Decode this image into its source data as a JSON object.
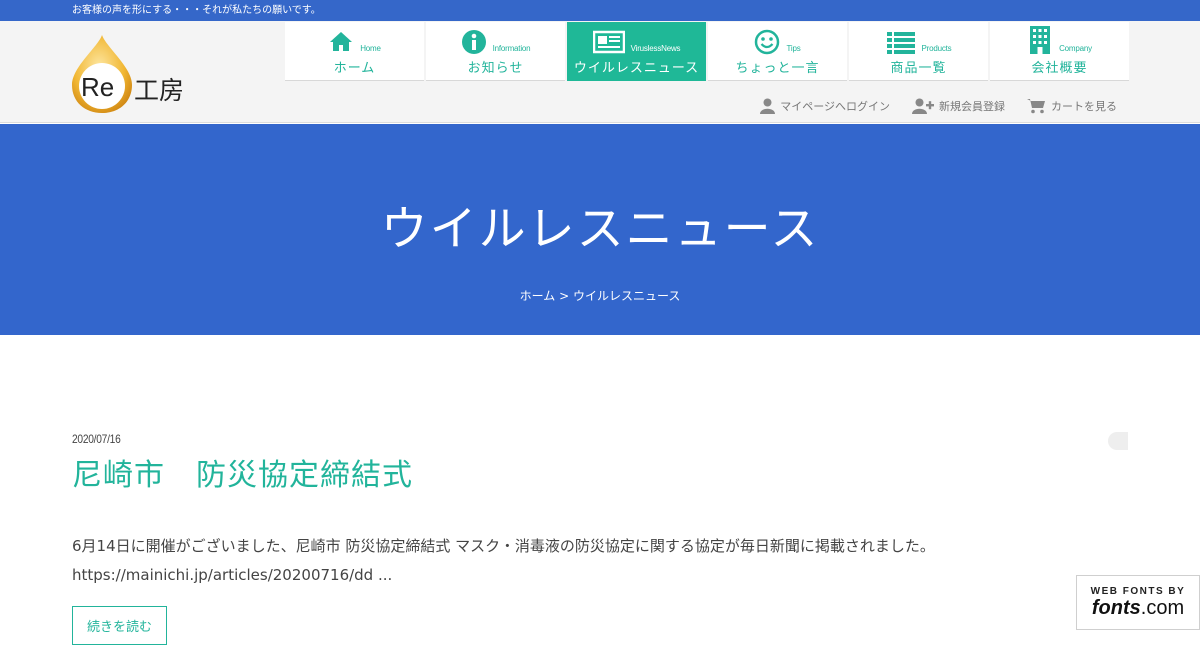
{
  "topbar": {
    "tagline": "お客様の声を形にする・・・それが私たちの願いです。"
  },
  "logo": {
    "prefix": "Re",
    "name": "工房"
  },
  "nav": [
    {
      "en": "Home",
      "ja": "ホーム",
      "icon": "home-icon"
    },
    {
      "en": "Information",
      "ja": "お知らせ",
      "icon": "info-icon"
    },
    {
      "en": "ViruslessNews",
      "ja": "ウイルレスニュース",
      "icon": "newspaper-icon",
      "active": true
    },
    {
      "en": "Tips",
      "ja": "ちょっと一言",
      "icon": "smile-icon"
    },
    {
      "en": "Products",
      "ja": "商品一覧",
      "icon": "list-icon"
    },
    {
      "en": "Company",
      "ja": "会社概要",
      "icon": "building-icon"
    }
  ],
  "util": {
    "login": "マイページへログイン",
    "register": "新規会員登録",
    "cart": "カートを見る"
  },
  "hero": {
    "title": "ウイルレスニュース",
    "breadcrumb": "ホーム > ウイルレスニュース"
  },
  "post": {
    "date": "2020/07/16",
    "title": "尼崎市　防災協定締結式",
    "excerpt_line1": "6月14日に開催がございました、尼崎市 防災協定締結式 マスク・消毒液の防災協定に関する協定が毎日新聞に掲載されました。",
    "excerpt_line2": "https://mainichi.jp/articles/20200716/dd ...",
    "more_label": "続きを読む"
  },
  "badge": {
    "top": "WEB FONTS BY",
    "brand": "fonts",
    "suffix": ".com"
  },
  "colors": {
    "blue": "#3366cc",
    "teal": "#1fb897",
    "logo_orange": "#e8a317"
  }
}
